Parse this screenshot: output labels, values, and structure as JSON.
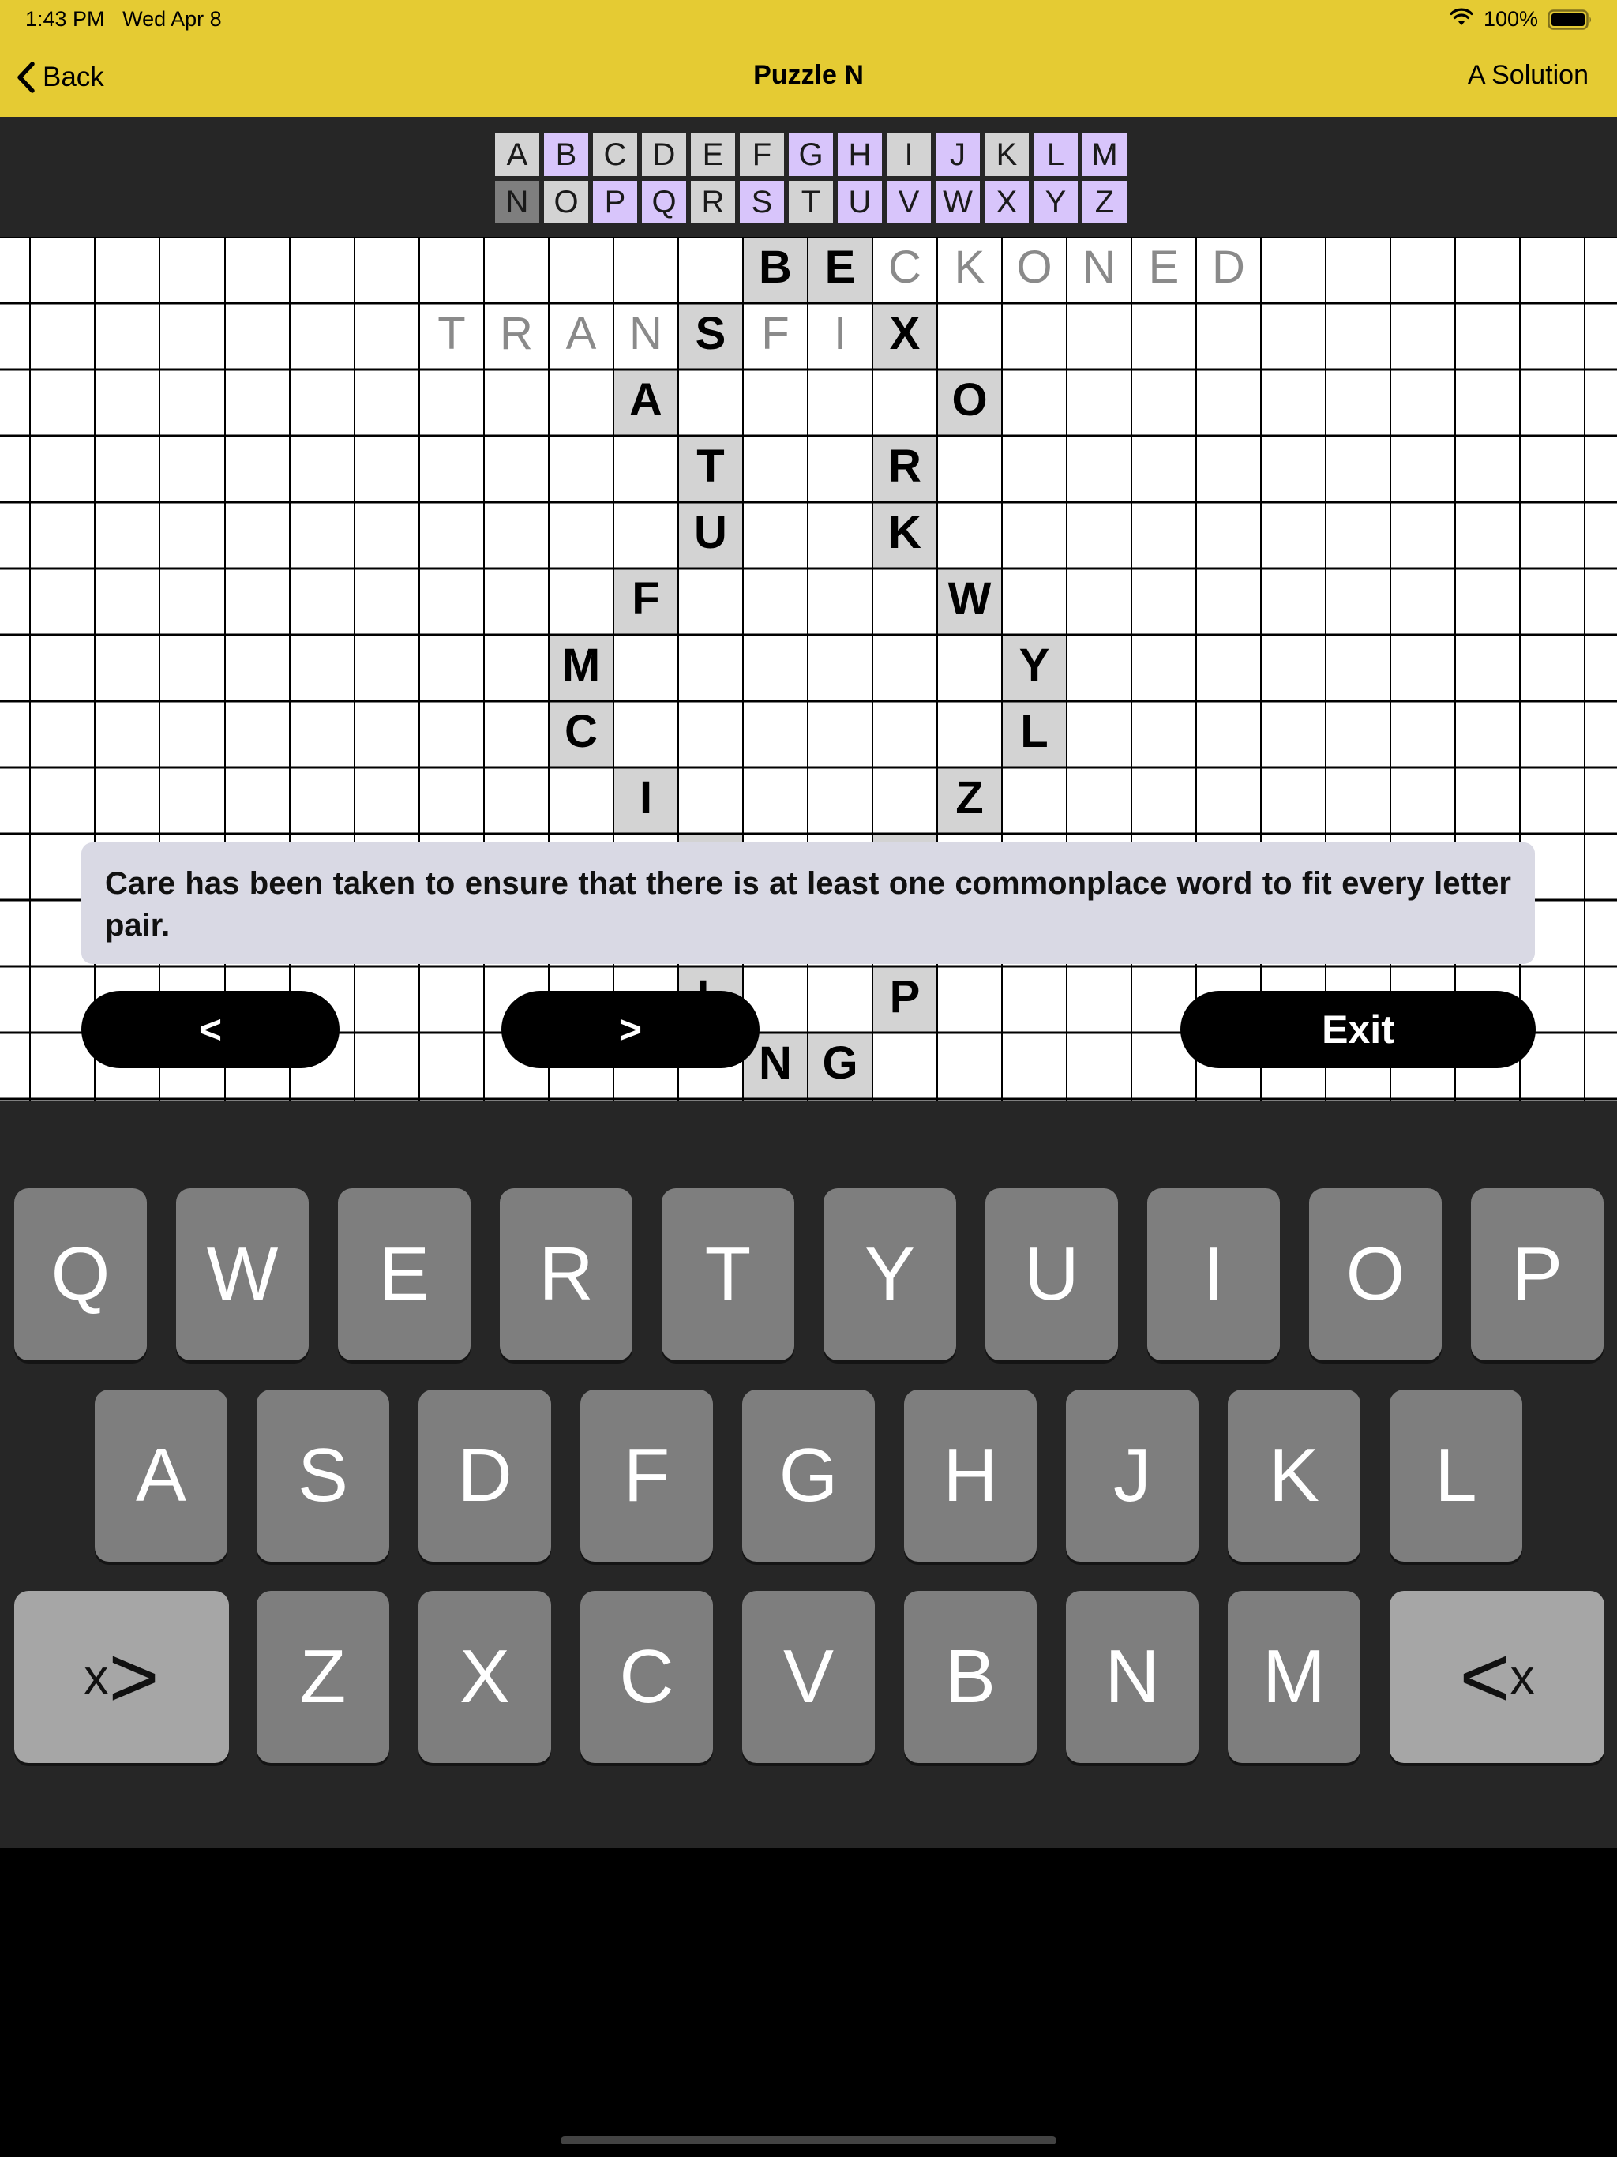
{
  "status_bar": {
    "time": "1:43 PM",
    "date": "Wed Apr 8",
    "battery": "100%"
  },
  "nav": {
    "back_label": "Back",
    "title": "Puzzle N",
    "solution_label": "A Solution"
  },
  "alphabet": {
    "rows": [
      [
        {
          "l": "A",
          "s": "plain"
        },
        {
          "l": "B",
          "s": "found"
        },
        {
          "l": "C",
          "s": "plain"
        },
        {
          "l": "D",
          "s": "plain"
        },
        {
          "l": "E",
          "s": "plain"
        },
        {
          "l": "F",
          "s": "plain"
        },
        {
          "l": "G",
          "s": "found"
        },
        {
          "l": "H",
          "s": "found"
        },
        {
          "l": "I",
          "s": "plain"
        },
        {
          "l": "J",
          "s": "found"
        },
        {
          "l": "K",
          "s": "plain"
        },
        {
          "l": "L",
          "s": "found"
        },
        {
          "l": "M",
          "s": "found"
        }
      ],
      [
        {
          "l": "N",
          "s": "current"
        },
        {
          "l": "O",
          "s": "plain"
        },
        {
          "l": "P",
          "s": "found"
        },
        {
          "l": "Q",
          "s": "found"
        },
        {
          "l": "R",
          "s": "plain"
        },
        {
          "l": "S",
          "s": "found"
        },
        {
          "l": "T",
          "s": "plain"
        },
        {
          "l": "U",
          "s": "found"
        },
        {
          "l": "V",
          "s": "found"
        },
        {
          "l": "W",
          "s": "found"
        },
        {
          "l": "X",
          "s": "found"
        },
        {
          "l": "Y",
          "s": "found"
        },
        {
          "l": "Z",
          "s": "found"
        }
      ]
    ]
  },
  "grid": {
    "given_letters": [
      {
        "r": 0,
        "c": 11,
        "l": "B"
      },
      {
        "r": 0,
        "c": 12,
        "l": "E"
      },
      {
        "r": 1,
        "c": 10,
        "l": "S"
      },
      {
        "r": 1,
        "c": 13,
        "l": "X"
      },
      {
        "r": 2,
        "c": 9,
        "l": "A"
      },
      {
        "r": 2,
        "c": 14,
        "l": "O"
      },
      {
        "r": 3,
        "c": 10,
        "l": "T"
      },
      {
        "r": 3,
        "c": 13,
        "l": "R"
      },
      {
        "r": 4,
        "c": 10,
        "l": "U"
      },
      {
        "r": 4,
        "c": 13,
        "l": "K"
      },
      {
        "r": 5,
        "c": 9,
        "l": "F"
      },
      {
        "r": 5,
        "c": 14,
        "l": "W"
      },
      {
        "r": 6,
        "c": 8,
        "l": "M"
      },
      {
        "r": 6,
        "c": 15,
        "l": "Y"
      },
      {
        "r": 7,
        "c": 8,
        "l": "C"
      },
      {
        "r": 7,
        "c": 15,
        "l": "L"
      },
      {
        "r": 8,
        "c": 9,
        "l": "I"
      },
      {
        "r": 8,
        "c": 14,
        "l": "Z"
      },
      {
        "r": 11,
        "c": 13,
        "l": "P"
      },
      {
        "r": 12,
        "c": 11,
        "l": "N"
      },
      {
        "r": 12,
        "c": 12,
        "l": "G"
      }
    ],
    "hint_letters": [
      {
        "r": 0,
        "c": 13,
        "l": "C"
      },
      {
        "r": 0,
        "c": 14,
        "l": "K"
      },
      {
        "r": 0,
        "c": 15,
        "l": "O"
      },
      {
        "r": 0,
        "c": 16,
        "l": "N"
      },
      {
        "r": 0,
        "c": 17,
        "l": "E"
      },
      {
        "r": 0,
        "c": 18,
        "l": "D"
      },
      {
        "r": 1,
        "c": 6,
        "l": "T"
      },
      {
        "r": 1,
        "c": 7,
        "l": "R"
      },
      {
        "r": 1,
        "c": 8,
        "l": "A"
      },
      {
        "r": 1,
        "c": 9,
        "l": "N"
      },
      {
        "r": 1,
        "c": 11,
        "l": "F"
      },
      {
        "r": 1,
        "c": 12,
        "l": "I"
      }
    ],
    "plain_shaded_cells": [
      {
        "r": 9,
        "c": 10
      },
      {
        "r": 9,
        "c": 13
      },
      {
        "r": 11,
        "c": 10
      }
    ],
    "partial_letters": [
      {
        "r": 11,
        "c": 10,
        "l": "L"
      }
    ]
  },
  "info_message": "Care has been taken to ensure that there is at least one commonplace word to fit every letter pair.",
  "buttons": {
    "prev": "<",
    "next": ">",
    "exit": "Exit"
  },
  "keyboard": {
    "row1": [
      "Q",
      "W",
      "E",
      "R",
      "T",
      "Y",
      "U",
      "I",
      "O",
      "P"
    ],
    "row2": [
      "A",
      "S",
      "D",
      "F",
      "G",
      "H",
      "J",
      "K",
      "L"
    ],
    "row3": [
      "Z",
      "X",
      "C",
      "V",
      "B",
      "N",
      "M"
    ],
    "left_special": {
      "small": "x",
      "big": ">"
    },
    "right_special": {
      "big": "<",
      "small": "x"
    }
  },
  "colors": {
    "nav_bar": "#e5cb33",
    "dark_panel": "#262626",
    "found_letter": "#d8c5fb",
    "shaded_cell": "#d3d3d3",
    "key": "#7e7e7e",
    "toast": "#d9d9e4"
  },
  "icons": {
    "back": "chevron-left-icon",
    "wifi": "wifi-icon",
    "battery": "battery-icon"
  }
}
